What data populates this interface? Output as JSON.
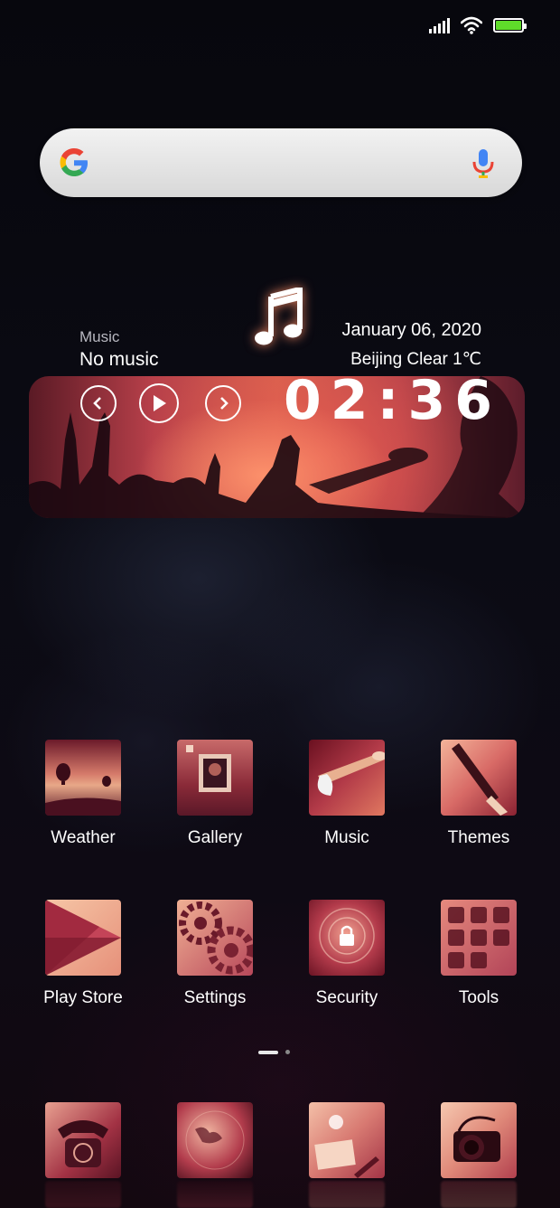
{
  "status_bar": {
    "signal_bars": 5,
    "wifi": "wifi-icon",
    "battery_percent": 100,
    "battery_color": "#5fdc2a"
  },
  "search": {
    "logo": "google-g-logo",
    "mic": "mic-icon"
  },
  "music_widget": {
    "label": "Music",
    "status": "No music",
    "date": "January  06, 2020",
    "weather": "Beijing  Clear  1℃",
    "time": "02:36",
    "controls": [
      "previous-icon",
      "play-icon",
      "next-icon"
    ]
  },
  "apps": [
    {
      "name": "Weather"
    },
    {
      "name": "Gallery"
    },
    {
      "name": "Music"
    },
    {
      "name": "Themes"
    },
    {
      "name": "Play Store"
    },
    {
      "name": "Settings"
    },
    {
      "name": "Security"
    },
    {
      "name": "Tools"
    }
  ],
  "dock": [
    "phone",
    "browser",
    "messages",
    "camera"
  ],
  "page_indicator": {
    "pages": 2,
    "current": 1
  }
}
